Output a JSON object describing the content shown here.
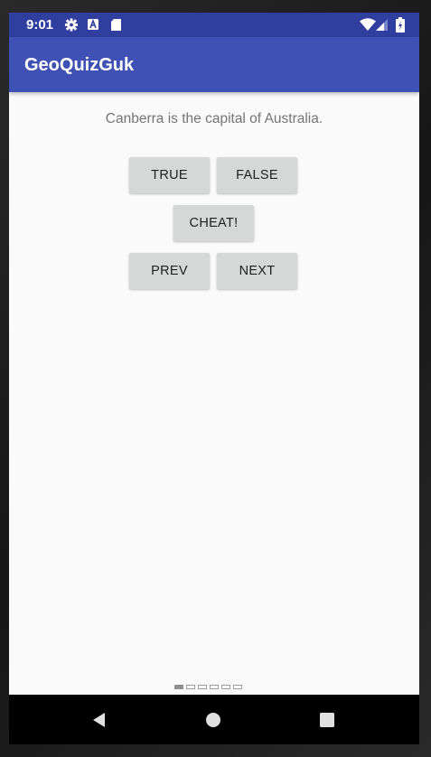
{
  "status_bar": {
    "time": "9:01",
    "left_icons": [
      "gear-icon",
      "a-box-icon",
      "sd-card-icon"
    ],
    "right_icons": [
      "wifi-icon",
      "cell-signal-icon",
      "battery-icon"
    ],
    "color": "#303f9f"
  },
  "app_bar": {
    "title": "GeoQuizGuk",
    "color": "#3f51b5"
  },
  "question": {
    "text": "Canberra is the capital of Australia."
  },
  "buttons": {
    "true_label": "TRUE",
    "false_label": "FALSE",
    "cheat_label": "CHEAT!",
    "prev_label": "PREV",
    "next_label": "NEXT"
  },
  "page_indicator": {
    "count": 6,
    "active": 1
  },
  "nav_bar": {
    "icons": [
      "back-icon",
      "home-icon",
      "recents-icon"
    ]
  }
}
